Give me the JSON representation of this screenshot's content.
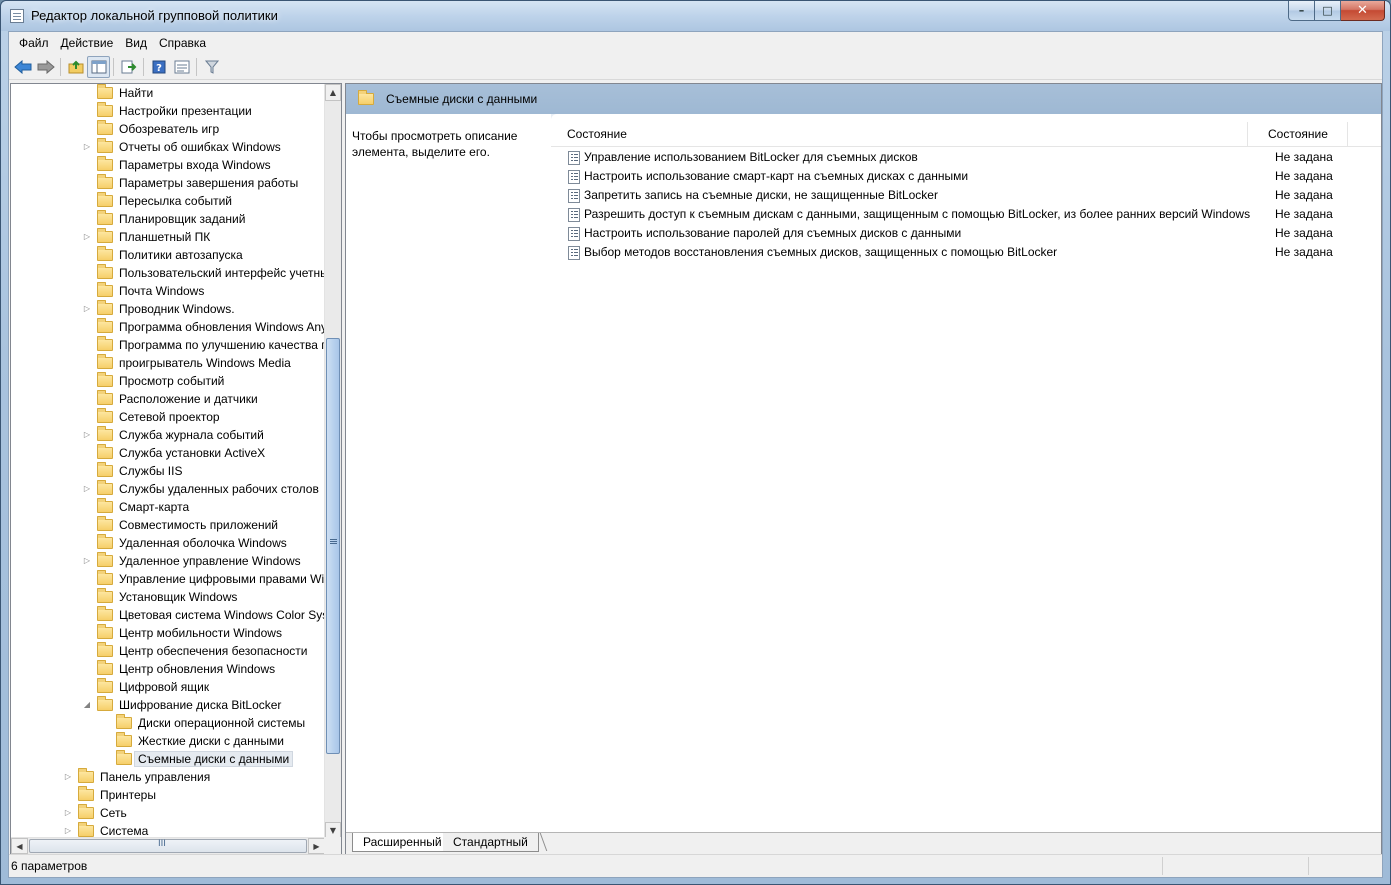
{
  "window": {
    "title": "Редактор локальной групповой политики",
    "controls": {
      "minimize": "–",
      "maximize": "□",
      "close": "✕"
    }
  },
  "menu": [
    {
      "label": "Файл"
    },
    {
      "label": "Действие"
    },
    {
      "label": "Вид"
    },
    {
      "label": "Справка"
    }
  ],
  "toolbar": {
    "icons": [
      "back-arrow-icon",
      "forward-arrow-icon",
      "up-folder-icon",
      "show-hide-tree-icon",
      "export-list-icon",
      "help-icon",
      "properties-view-icon",
      "filter-icon"
    ]
  },
  "tree": {
    "items": [
      {
        "label": "Найти",
        "level": 2,
        "expandable": false
      },
      {
        "label": "Настройки презентации",
        "level": 2,
        "expandable": false
      },
      {
        "label": "Обозреватель игр",
        "level": 2,
        "expandable": false
      },
      {
        "label": "Отчеты об ошибках Windows",
        "level": 2,
        "expandable": true
      },
      {
        "label": "Параметры входа Windows",
        "level": 2,
        "expandable": false
      },
      {
        "label": "Параметры завершения работы",
        "level": 2,
        "expandable": false
      },
      {
        "label": "Пересылка событий",
        "level": 2,
        "expandable": false
      },
      {
        "label": "Планировщик заданий",
        "level": 2,
        "expandable": false
      },
      {
        "label": "Планшетный ПК",
        "level": 2,
        "expandable": true
      },
      {
        "label": "Политики автозапуска",
        "level": 2,
        "expandable": false
      },
      {
        "label": "Пользовательский интерфейс учетных",
        "level": 2,
        "expandable": false
      },
      {
        "label": "Почта Windows",
        "level": 2,
        "expandable": false
      },
      {
        "label": "Проводник Windows.",
        "level": 2,
        "expandable": true
      },
      {
        "label": "Программа обновления Windows Any",
        "level": 2,
        "expandable": false
      },
      {
        "label": "Программа по улучшению качества п",
        "level": 2,
        "expandable": false
      },
      {
        "label": "проигрыватель Windows Media",
        "level": 2,
        "expandable": false
      },
      {
        "label": "Просмотр событий",
        "level": 2,
        "expandable": false
      },
      {
        "label": "Расположение и датчики",
        "level": 2,
        "expandable": false
      },
      {
        "label": "Сетевой проектор",
        "level": 2,
        "expandable": false
      },
      {
        "label": "Служба журнала событий",
        "level": 2,
        "expandable": true
      },
      {
        "label": "Служба установки ActiveX",
        "level": 2,
        "expandable": false
      },
      {
        "label": "Службы IIS",
        "level": 2,
        "expandable": false
      },
      {
        "label": "Службы удаленных рабочих столов",
        "level": 2,
        "expandable": true
      },
      {
        "label": "Смарт-карта",
        "level": 2,
        "expandable": false
      },
      {
        "label": "Совместимость приложений",
        "level": 2,
        "expandable": false
      },
      {
        "label": "Удаленная оболочка Windows",
        "level": 2,
        "expandable": false
      },
      {
        "label": "Удаленное управление Windows",
        "level": 2,
        "expandable": true
      },
      {
        "label": "Управление цифровыми правами Win",
        "level": 2,
        "expandable": false
      },
      {
        "label": "Установщик Windows",
        "level": 2,
        "expandable": false
      },
      {
        "label": "Цветовая система Windows Color Syste",
        "level": 2,
        "expandable": false
      },
      {
        "label": "Центр мобильности Windows",
        "level": 2,
        "expandable": false
      },
      {
        "label": "Центр обеспечения безопасности",
        "level": 2,
        "expandable": false
      },
      {
        "label": "Центр обновления Windows",
        "level": 2,
        "expandable": false
      },
      {
        "label": "Цифровой ящик",
        "level": 2,
        "expandable": false
      },
      {
        "label": "Шифрование диска BitLocker",
        "level": 2,
        "expandable": true,
        "expanded": true
      },
      {
        "label": "Диски операционной системы",
        "level": 3,
        "expandable": false
      },
      {
        "label": "Жесткие диски с данными",
        "level": 3,
        "expandable": false
      },
      {
        "label": "Съемные диски с данными",
        "level": 3,
        "expandable": false,
        "selected": true
      },
      {
        "label": "Панель управления",
        "level": 1,
        "expandable": true
      },
      {
        "label": "Принтеры",
        "level": 1,
        "expandable": false
      },
      {
        "label": "Сеть",
        "level": 1,
        "expandable": true
      },
      {
        "label": "Система",
        "level": 1,
        "expandable": true
      }
    ]
  },
  "scroll": {
    "grip": "≡",
    "hgrip": "III",
    "up": "▲",
    "down": "▼",
    "left": "◀",
    "right": "▶"
  },
  "details": {
    "header_title": "Съемные диски с данными",
    "description": "Чтобы просмотреть описание элемента, выделите его.",
    "columns": {
      "name": "Состояние",
      "state": "Состояние"
    },
    "rows": [
      {
        "name": "Управление использованием BitLocker для съемных дисков",
        "state": "Не задана"
      },
      {
        "name": "Настроить использование смарт-карт на съемных дисках с данными",
        "state": "Не задана"
      },
      {
        "name": "Запретить запись на съемные диски, не защищенные BitLocker",
        "state": "Не задана"
      },
      {
        "name": "Разрешить доступ к съемным дискам с данными, защищенным с помощью BitLocker, из более ранних версий Windows",
        "state": "Не задана"
      },
      {
        "name": "Настроить использование паролей для съемных дисков с данными",
        "state": "Не задана"
      },
      {
        "name": "Выбор методов восстановления съемных дисков, защищенных с помощью BitLocker",
        "state": "Не задана"
      }
    ],
    "tabs": [
      {
        "label": "Расширенный",
        "active": true
      },
      {
        "label": "Стандартный",
        "active": false
      }
    ]
  },
  "status": {
    "text": "6 параметров"
  }
}
